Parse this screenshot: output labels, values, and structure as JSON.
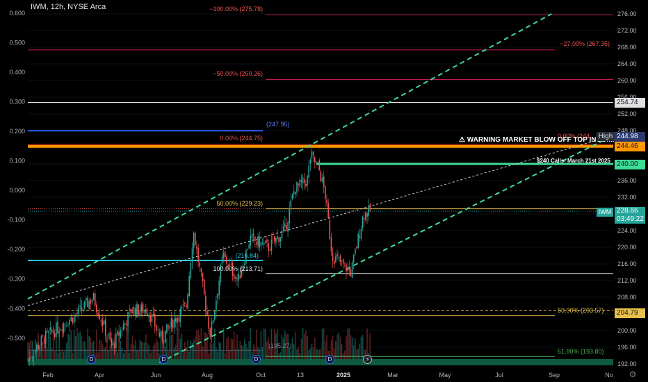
{
  "header": {
    "symbol_line": "IWM, 12h, NYSE Arca"
  },
  "colors": {
    "background": "#000000",
    "up": "#26a69a",
    "down": "#ef5350",
    "fib_red": "#ef5350",
    "fib_yellow": "#e8c04c",
    "fib_green": "#4caf50",
    "channel_green": "#3ddc97",
    "orange": "#ff9800",
    "white_line": "#e0e0e0",
    "blue_line": "#2962ff",
    "cyan_line": "#00bcd4"
  },
  "annotations": {
    "warning": "⚠ WARNING MARKET BLOW OFF TOP INCOMING ⚠",
    "calls": "$240 Calls- March 21st 2025"
  },
  "fib_labels": {
    "m100": "−100.00% (275.78)",
    "m27": "−27.00% (267.35)",
    "m50": "−50.00% (260.26)",
    "blue": "(247.95)",
    "zero": "0.00% (244.75)",
    "zero_right": "0.00% (244.",
    "fifty": "50.00% (229.23)",
    "hundred": "100.00% (213.71)",
    "cyan": "(216.84)",
    "fifty_low": "50.00% (203.57)",
    "bottom": "(195.27)",
    "sixtyone": "61.80% (193.80)"
  },
  "price_tags": {
    "t254": "254.74",
    "high_label": "High",
    "t244_98": "244.98",
    "t244_46": "244.46",
    "t240": "240.00",
    "iwm_label": "IWM",
    "iwm_price": "228.66",
    "iwm_countdown": "03:49:22",
    "t204": "204.79"
  },
  "markers": {
    "dividend": "D",
    "bolt": "⚡",
    "gear": "⚙"
  },
  "chart_data": {
    "type": "candlestick",
    "symbol": "IWM",
    "interval": "12h",
    "exchange": "NYSE Arca",
    "right_axis": {
      "ticks": [
        "276.00",
        "272.00",
        "268.00",
        "264.00",
        "260.00",
        "256.00",
        "252.00",
        "248.00",
        "244.00",
        "240.00",
        "236.00",
        "232.00",
        "228.00",
        "224.00",
        "220.00",
        "216.00",
        "212.00",
        "208.00",
        "204.00",
        "200.00",
        "196.00",
        "192.00"
      ],
      "range": [
        191.6,
        277.3
      ]
    },
    "left_axis": {
      "ticks": [
        "0.600",
        "0.500",
        "0.400",
        "0.300",
        "0.200",
        "0.100",
        "0.000",
        "-0.100",
        "-0.200",
        "-0.300",
        "-0.400",
        "-0.500"
      ],
      "range": [
        -0.585,
        0.623
      ]
    },
    "x_axis": {
      "labels": [
        "Feb",
        "Apr",
        "Jun",
        "Aug",
        "Oct",
        "13",
        "2025",
        "Mar",
        "May",
        "Jul",
        "Sep",
        "No"
      ],
      "bold": [
        "2025"
      ]
    },
    "price_path": [
      [
        "2024-01-15",
        193
      ],
      [
        "2024-02-01",
        198
      ],
      [
        "2024-02-20",
        201
      ],
      [
        "2024-03-10",
        204
      ],
      [
        "2024-03-28",
        208
      ],
      [
        "2024-04-18",
        196
      ],
      [
        "2024-05-10",
        205
      ],
      [
        "2024-05-28",
        205
      ],
      [
        "2024-06-12",
        198
      ],
      [
        "2024-06-28",
        203
      ],
      [
        "2024-07-10",
        206
      ],
      [
        "2024-07-18",
        224
      ],
      [
        "2024-08-06",
        199
      ],
      [
        "2024-08-20",
        218
      ],
      [
        "2024-09-06",
        212
      ],
      [
        "2024-09-19",
        222
      ],
      [
        "2024-10-10",
        220
      ],
      [
        "2024-10-28",
        224
      ],
      [
        "2024-11-08",
        234
      ],
      [
        "2024-11-22",
        236
      ],
      [
        "2024-11-26",
        242
      ],
      [
        "2024-12-05",
        239
      ],
      [
        "2024-12-12",
        233
      ],
      [
        "2024-12-20",
        218
      ],
      [
        "2025-01-10",
        214
      ],
      [
        "2025-01-24",
        228
      ],
      [
        "2025-02-01",
        228.66
      ]
    ],
    "current_price": 228.66,
    "levels": [
      {
        "label": "−100.00% (275.78)",
        "price": 275.78
      },
      {
        "label": "−27.00% (267.35)",
        "price": 267.35
      },
      {
        "label": "−50.00% (260.26)",
        "price": 260.26
      },
      {
        "label": "",
        "price": 254.74
      },
      {
        "label": "(247.95)",
        "price": 247.95
      },
      {
        "label": "0.00% (244.75)",
        "price": 244.75
      },
      {
        "label": "",
        "price": 244.46
      },
      {
        "label": "$240 Calls- March 21st 2025",
        "price": 240.0
      },
      {
        "label": "50.00% (229.23)",
        "price": 229.23
      },
      {
        "label": "(216.84)",
        "price": 216.84
      },
      {
        "label": "100.00% (213.71)",
        "price": 213.71
      },
      {
        "label": "50.00% (203.57)",
        "price": 203.57
      },
      {
        "label": "",
        "price": 204.79
      },
      {
        "label": "(195.27)",
        "price": 195.27
      },
      {
        "label": "61.80% (193.80)",
        "price": 193.8
      }
    ]
  }
}
